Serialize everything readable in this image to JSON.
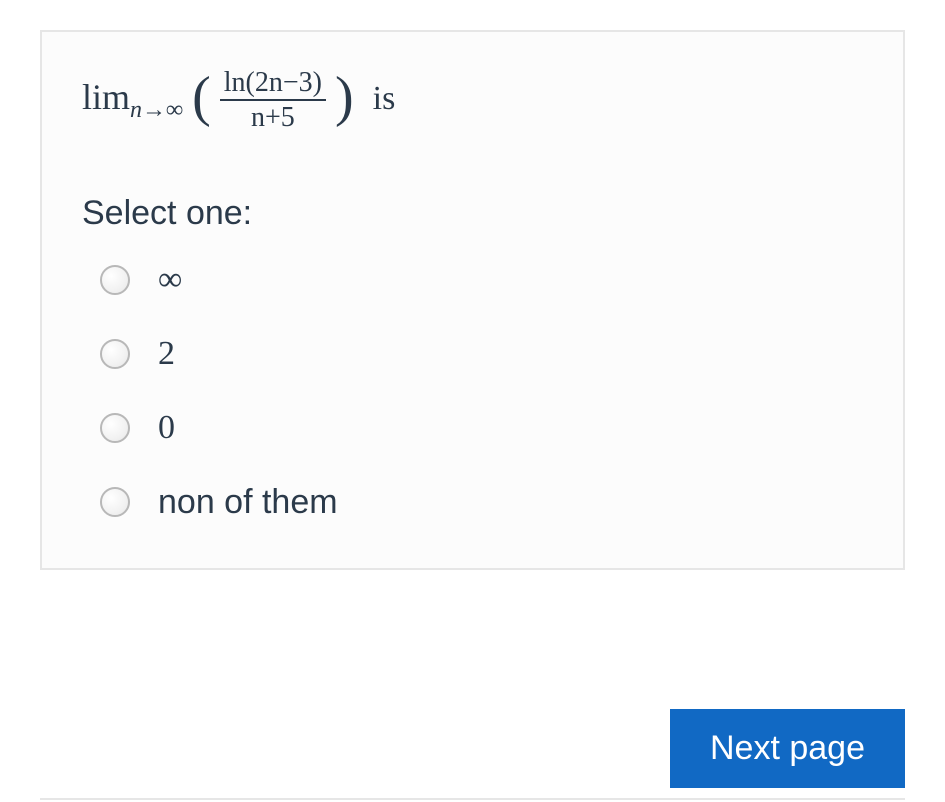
{
  "question": {
    "lim_text": "lim",
    "lim_sub": "n→∞",
    "paren_open": "(",
    "frac_top": "ln(2n−3)",
    "frac_bot": "n+5",
    "paren_close": ")",
    "trailing": "is"
  },
  "select_label": "Select one:",
  "options": [
    {
      "label": "∞"
    },
    {
      "label": "2"
    },
    {
      "label": "0"
    },
    {
      "label": "non of them"
    }
  ],
  "next_button": "Next page"
}
